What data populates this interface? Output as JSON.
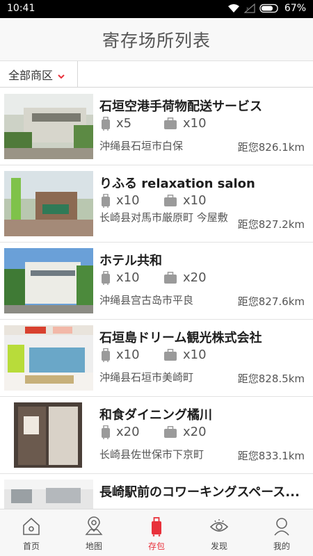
{
  "status_bar": {
    "time": "10:41",
    "battery": "67%",
    "icons": [
      "wifi-icon",
      "signal-icon",
      "battery-icon"
    ]
  },
  "header": {
    "title": "寄存场所列表"
  },
  "filter": {
    "label": "全部商区",
    "chevron_color": "#e8313b"
  },
  "items": [
    {
      "name": "石垣空港手荷物配送サービス",
      "suitcase": "x5",
      "bag": "x10",
      "address": "沖绳县石垣市白保",
      "distance": "距您826.1km"
    },
    {
      "name": "りふる relaxation salon",
      "suitcase": "x10",
      "bag": "x10",
      "address": "长崎县对馬市厳原町 今屋敷",
      "distance": "距您827.2km"
    },
    {
      "name": "ホテル共和",
      "suitcase": "x10",
      "bag": "x20",
      "address": "沖绳县宫古岛市平良",
      "distance": "距您827.6km"
    },
    {
      "name": "石垣島ドリーム観光株式会社",
      "suitcase": "x10",
      "bag": "x10",
      "address": "沖绳县石垣市美崎町",
      "distance": "距您828.5km"
    },
    {
      "name": "和食ダイニング橘川",
      "suitcase": "x20",
      "bag": "x20",
      "address": "长崎县佐世保市下京町",
      "distance": "距您833.1km"
    },
    {
      "name": "長崎駅前のコワーキングスペース...",
      "suitcase": "",
      "bag": "",
      "address": "",
      "distance": ""
    }
  ],
  "nav": {
    "items": [
      {
        "label": "首页",
        "icon": "home-icon"
      },
      {
        "label": "地图",
        "icon": "map-pin-icon"
      },
      {
        "label": "存包",
        "icon": "luggage-icon"
      },
      {
        "label": "发现",
        "icon": "eye-icon"
      },
      {
        "label": "我的",
        "icon": "user-icon"
      }
    ],
    "active_color": "#e8313b"
  }
}
